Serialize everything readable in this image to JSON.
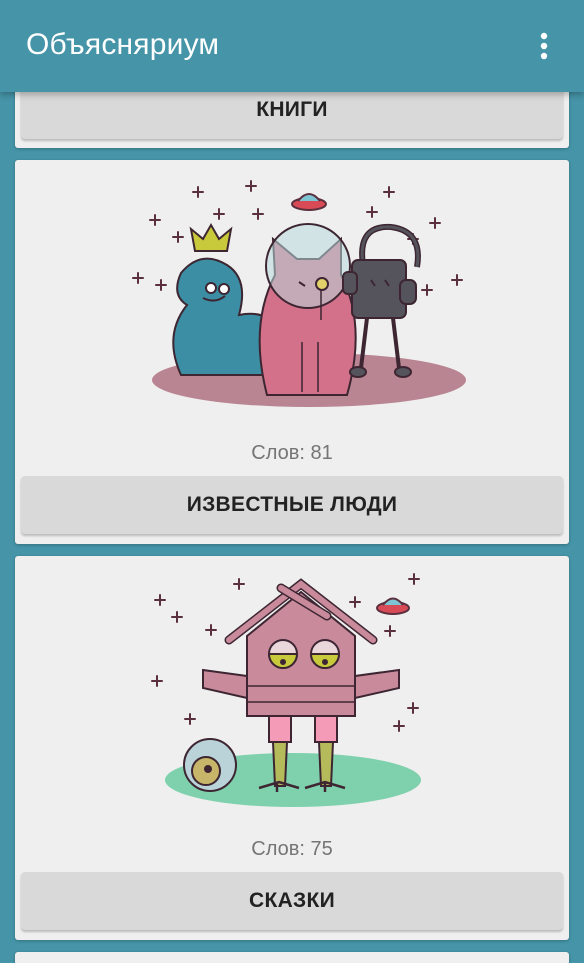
{
  "app": {
    "title": "Объясняриум"
  },
  "categories": [
    {
      "label": "КНИГИ"
    },
    {
      "label": "ИЗВЕСТНЫЕ ЛЮДИ",
      "word_count": "Слов: 81"
    },
    {
      "label": "СКАЗКИ",
      "word_count": "Слов: 75"
    }
  ],
  "colors": {
    "appbar": "#4694a8",
    "card": "#efefef",
    "button": "#d9d9d9"
  }
}
